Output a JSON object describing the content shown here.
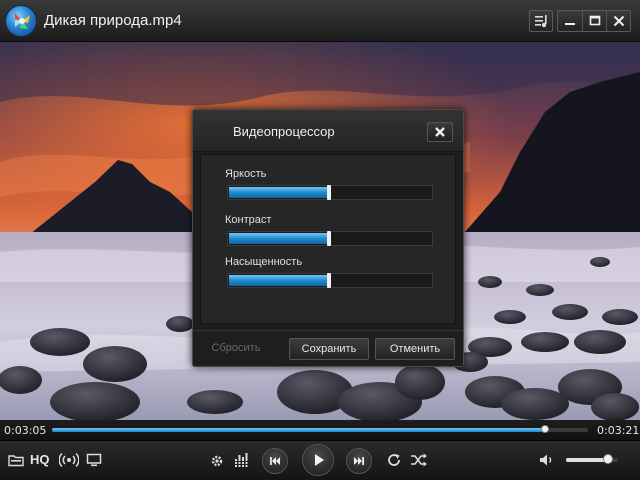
{
  "window": {
    "title": "Дикая природа.mp4"
  },
  "video": {
    "scene_icon": "landscape-image"
  },
  "dialog": {
    "title": "Видеопроцессор",
    "sliders": [
      {
        "label": "Яркость",
        "value": 0.5
      },
      {
        "label": "Контраст",
        "value": 0.5
      },
      {
        "label": "Насыщенность",
        "value": 0.5
      }
    ],
    "reset_label": "Сбросить",
    "save_label": "Сохранить",
    "cancel_label": "Отменить"
  },
  "playback": {
    "current_time": "0:03:05",
    "total_time": "0:03:21",
    "progress": 0.92
  },
  "controls": {
    "hq_label": "HQ",
    "volume": 0.8
  },
  "colors": {
    "accent": "#1d86c8",
    "accent_light": "#6ec6f5"
  }
}
